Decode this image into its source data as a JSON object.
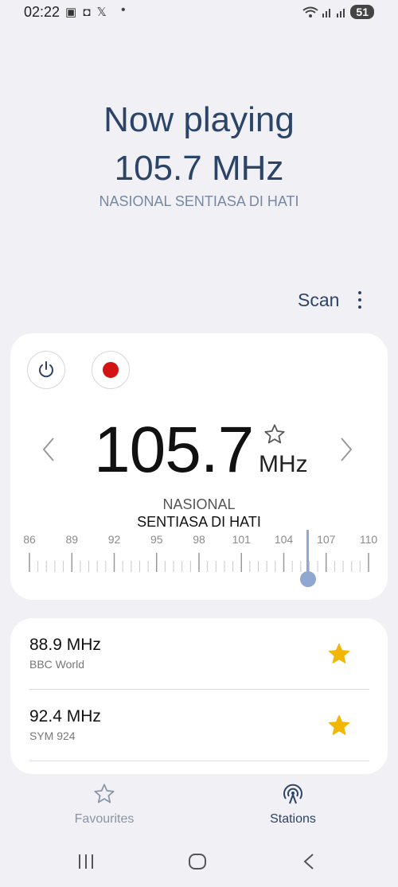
{
  "status": {
    "time": "02:22",
    "notif_icons": "▣ ◘ 𝕏",
    "battery": "51"
  },
  "now_playing": {
    "title": "Now playing",
    "frequency": "105.7 MHz",
    "station": "NASIONAL SENTIASA DI HATI"
  },
  "toolbar": {
    "scan_label": "Scan"
  },
  "tuner": {
    "frequency": "105.7",
    "unit": "MHz",
    "station_line1": "NASIONAL",
    "station_line2": "SENTIASA DI HATI",
    "scale_labels": [
      "86",
      "89",
      "92",
      "95",
      "98",
      "101",
      "104",
      "107",
      "110"
    ],
    "scale_min": 86,
    "scale_max": 110,
    "current_value": 105.7
  },
  "favourites_list": [
    {
      "frequency": "88.9 MHz",
      "name": "BBC World",
      "starred": true
    },
    {
      "frequency": "92.4 MHz",
      "name": "SYM 924",
      "starred": true
    }
  ],
  "tabs": {
    "favourites": "Favourites",
    "stations": "Stations",
    "active": "stations"
  },
  "colors": {
    "accent": "#2b4468",
    "star": "#f2b705",
    "record": "#d21414",
    "needle": "#8ea8d2"
  }
}
